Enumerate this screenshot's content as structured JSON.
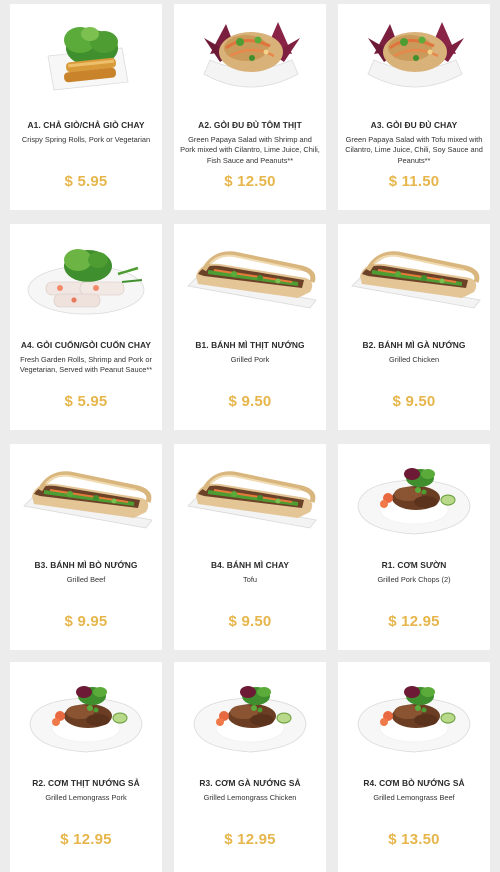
{
  "colors": {
    "background": "#ececec",
    "card": "#ffffff",
    "price": "#e6b64c",
    "text": "#2b2b2b"
  },
  "items": [
    {
      "code_name": "A1. CHẢ GIÒ/CHẢ GIÒ CHAY",
      "description": "Crispy Spring Rolls, Pork or Vegetarian",
      "price": "$ 5.95",
      "image": "spring-rolls-image"
    },
    {
      "code_name": "A2. GỎI ĐU ĐỦ TÔM THỊT",
      "description": "Green Papaya Salad with Shrimp and Pork mixed with Cilantro, Lime Juice, Chili, Fish Sauce and Peanuts**",
      "price": "$ 12.50",
      "image": "papaya-salad-image"
    },
    {
      "code_name": "A3. GỎI ĐU ĐỦ CHAY",
      "description": "Green Papaya Salad with Tofu mixed with Cilantro, Lime Juice, Chili, Soy Sauce and Peanuts**",
      "price": "$ 11.50",
      "image": "papaya-salad-tofu-image"
    },
    {
      "code_name": "A4. GỎI CUỐN/GỎI CUỐN CHAY",
      "description": "Fresh Garden Rolls, Shrimp and Pork or Vegetarian, Served with Peanut Sauce**",
      "price": "$ 5.95",
      "image": "garden-rolls-image"
    },
    {
      "code_name": "B1. BÁNH MÌ THỊT NƯỚNG",
      "description": "Grilled Pork",
      "price": "$ 9.50",
      "image": "banh-mi-pork-image"
    },
    {
      "code_name": "B2. BÁNH MÌ GÀ NƯỚNG",
      "description": "Grilled Chicken",
      "price": "$ 9.50",
      "image": "banh-mi-chicken-image"
    },
    {
      "code_name": "B3. BÁNH MÌ BÒ NƯỚNG",
      "description": "Grilled Beef",
      "price": "$ 9.95",
      "image": "banh-mi-beef-image"
    },
    {
      "code_name": "B4. BÁNH MÌ CHAY",
      "description": "Tofu",
      "price": "$ 9.50",
      "image": "banh-mi-tofu-image"
    },
    {
      "code_name": "R1. CƠM SƯỜN",
      "description": "Grilled Pork Chops (2)",
      "price": "$ 12.95",
      "image": "pork-chop-rice-image"
    },
    {
      "code_name": "R2. CƠM THỊT NƯỚNG SẢ",
      "description": "Grilled Lemongrass Pork",
      "price": "$ 12.95",
      "image": "lemongrass-pork-rice-image"
    },
    {
      "code_name": "R3. CƠM GÀ NƯỚNG SẢ",
      "description": "Grilled Lemongrass Chicken",
      "price": "$ 12.95",
      "image": "lemongrass-chicken-rice-image"
    },
    {
      "code_name": "R4. CƠM BÒ NƯỚNG SẢ",
      "description": "Grilled Lemongrass Beef",
      "price": "$ 13.50",
      "image": "lemongrass-beef-rice-image"
    }
  ]
}
